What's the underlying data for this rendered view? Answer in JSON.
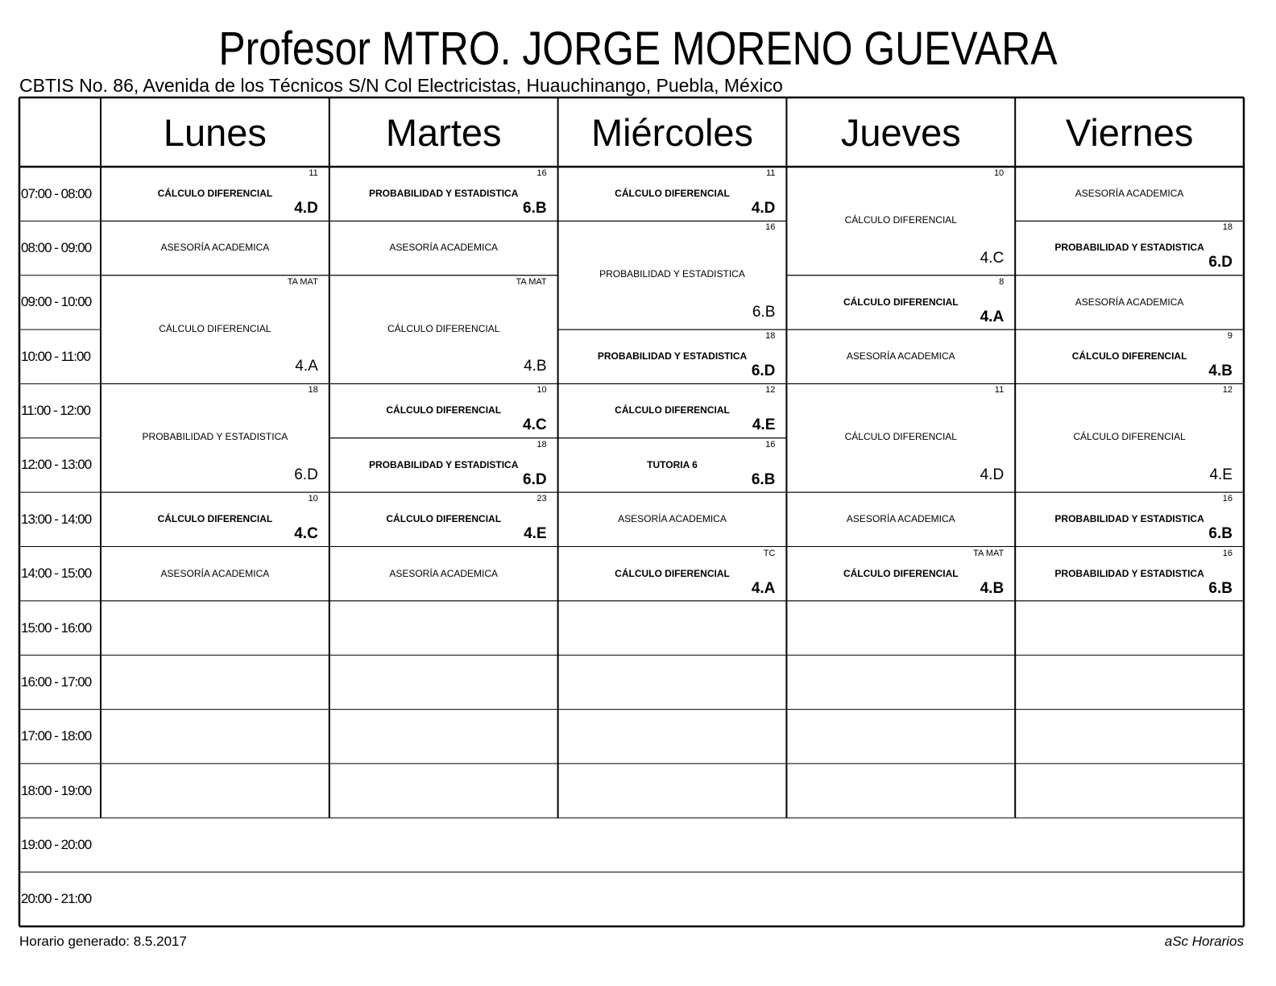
{
  "header": {
    "title": "Profesor MTRO. JORGE MORENO GUEVARA",
    "subtitle": "CBTIS No. 86, Avenida de los Técnicos S/N Col Electricistas, Huauchinango, Puebla, México"
  },
  "days": [
    "Lunes",
    "Martes",
    "Miércoles",
    "Jueves",
    "Viernes"
  ],
  "times": [
    "07:00 - 08:00",
    "08:00 - 09:00",
    "09:00 - 10:00",
    "10:00 - 11:00",
    "11:00 - 12:00",
    "12:00 - 13:00",
    "13:00 - 14:00",
    "14:00 - 15:00",
    "15:00 - 16:00",
    "16:00 - 17:00",
    "17:00 - 18:00",
    "18:00 - 19:00",
    "19:00 - 20:00",
    "20:00 - 21:00"
  ],
  "lessons": [
    {
      "day": 0,
      "start": 0,
      "span": 1,
      "subject": "CÁLCULO DIFERENCIAL",
      "room": "11",
      "class": "4.D",
      "bold": true
    },
    {
      "day": 0,
      "start": 1,
      "span": 1,
      "subject": "ASESORÍA ACADEMICA",
      "room": "",
      "class": "",
      "bold": false
    },
    {
      "day": 0,
      "start": 2,
      "span": 2,
      "subject": "CÁLCULO DIFERENCIAL",
      "room": "TA MAT",
      "class": "4.A",
      "bold": false
    },
    {
      "day": 0,
      "start": 4,
      "span": 2,
      "subject": "PROBABILIDAD Y ESTADISTICA",
      "room": "18",
      "class": "6.D",
      "bold": false
    },
    {
      "day": 0,
      "start": 6,
      "span": 1,
      "subject": "CÁLCULO DIFERENCIAL",
      "room": "10",
      "class": "4.C",
      "bold": true
    },
    {
      "day": 0,
      "start": 7,
      "span": 1,
      "subject": "ASESORÍA ACADEMICA",
      "room": "",
      "class": "",
      "bold": false
    },
    {
      "day": 1,
      "start": 0,
      "span": 1,
      "subject": "PROBABILIDAD Y ESTADISTICA",
      "room": "16",
      "class": "6.B",
      "bold": true
    },
    {
      "day": 1,
      "start": 1,
      "span": 1,
      "subject": "ASESORÍA ACADEMICA",
      "room": "",
      "class": "",
      "bold": false
    },
    {
      "day": 1,
      "start": 2,
      "span": 2,
      "subject": "CÁLCULO DIFERENCIAL",
      "room": "TA MAT",
      "class": "4.B",
      "bold": false
    },
    {
      "day": 1,
      "start": 4,
      "span": 1,
      "subject": "CÁLCULO DIFERENCIAL",
      "room": "10",
      "class": "4.C",
      "bold": true
    },
    {
      "day": 1,
      "start": 5,
      "span": 1,
      "subject": "PROBABILIDAD Y ESTADISTICA",
      "room": "18",
      "class": "6.D",
      "bold": true
    },
    {
      "day": 1,
      "start": 6,
      "span": 1,
      "subject": "CÁLCULO DIFERENCIAL",
      "room": "23",
      "class": "4.E",
      "bold": true
    },
    {
      "day": 1,
      "start": 7,
      "span": 1,
      "subject": "ASESORÍA ACADEMICA",
      "room": "",
      "class": "",
      "bold": false
    },
    {
      "day": 2,
      "start": 0,
      "span": 1,
      "subject": "CÁLCULO DIFERENCIAL",
      "room": "11",
      "class": "4.D",
      "bold": true
    },
    {
      "day": 2,
      "start": 1,
      "span": 2,
      "subject": "PROBABILIDAD Y ESTADISTICA",
      "room": "16",
      "class": "6.B",
      "bold": false
    },
    {
      "day": 2,
      "start": 3,
      "span": 1,
      "subject": "PROBABILIDAD Y ESTADISTICA",
      "room": "18",
      "class": "6.D",
      "bold": true
    },
    {
      "day": 2,
      "start": 4,
      "span": 1,
      "subject": "CÁLCULO DIFERENCIAL",
      "room": "12",
      "class": "4.E",
      "bold": true
    },
    {
      "day": 2,
      "start": 5,
      "span": 1,
      "subject": "TUTORIA 6",
      "room": "16",
      "class": "6.B",
      "bold": true
    },
    {
      "day": 2,
      "start": 6,
      "span": 1,
      "subject": "ASESORÍA ACADEMICA",
      "room": "",
      "class": "",
      "bold": false
    },
    {
      "day": 2,
      "start": 7,
      "span": 1,
      "subject": "CÁLCULO DIFERENCIAL",
      "room": "TC",
      "class": "4.A",
      "bold": true
    },
    {
      "day": 3,
      "start": 0,
      "span": 2,
      "subject": "CÁLCULO DIFERENCIAL",
      "room": "10",
      "class": "4.C",
      "bold": false
    },
    {
      "day": 3,
      "start": 2,
      "span": 1,
      "subject": "CÁLCULO DIFERENCIAL",
      "room": "8",
      "class": "4.A",
      "bold": true
    },
    {
      "day": 3,
      "start": 3,
      "span": 1,
      "subject": "ASESORÍA ACADEMICA",
      "room": "",
      "class": "",
      "bold": false
    },
    {
      "day": 3,
      "start": 4,
      "span": 2,
      "subject": "CÁLCULO DIFERENCIAL",
      "room": "11",
      "class": "4.D",
      "bold": false
    },
    {
      "day": 3,
      "start": 6,
      "span": 1,
      "subject": "ASESORÍA ACADEMICA",
      "room": "",
      "class": "",
      "bold": false
    },
    {
      "day": 3,
      "start": 7,
      "span": 1,
      "subject": "CÁLCULO DIFERENCIAL",
      "room": "TA MAT",
      "class": "4.B",
      "bold": true
    },
    {
      "day": 4,
      "start": 0,
      "span": 1,
      "subject": "ASESORÍA ACADEMICA",
      "room": "",
      "class": "",
      "bold": false
    },
    {
      "day": 4,
      "start": 1,
      "span": 1,
      "subject": "PROBABILIDAD Y ESTADISTICA",
      "room": "18",
      "class": "6.D",
      "bold": true
    },
    {
      "day": 4,
      "start": 2,
      "span": 1,
      "subject": "ASESORÍA ACADEMICA",
      "room": "",
      "class": "",
      "bold": false
    },
    {
      "day": 4,
      "start": 3,
      "span": 1,
      "subject": "CÁLCULO DIFERENCIAL",
      "room": "9",
      "class": "4.B",
      "bold": true
    },
    {
      "day": 4,
      "start": 4,
      "span": 2,
      "subject": "CÁLCULO DIFERENCIAL",
      "room": "12",
      "class": "4.E",
      "bold": false
    },
    {
      "day": 4,
      "start": 6,
      "span": 1,
      "subject": "PROBABILIDAD Y ESTADISTICA",
      "room": "16",
      "class": "6.B",
      "bold": true
    },
    {
      "day": 4,
      "start": 7,
      "span": 1,
      "subject": "PROBABILIDAD Y ESTADISTICA",
      "room": "16",
      "class": "6.B",
      "bold": true
    }
  ],
  "footer": {
    "generated": "Horario generado: 8.5.2017",
    "software": "aSc Horarios"
  }
}
